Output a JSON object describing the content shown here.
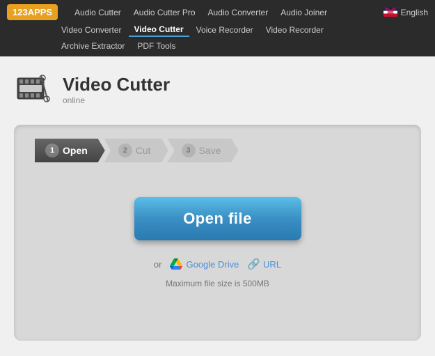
{
  "navbar": {
    "logo": "123APPS",
    "row1_links": [
      {
        "label": "Audio Cutter",
        "active": false
      },
      {
        "label": "Audio Cutter Pro",
        "active": false
      },
      {
        "label": "Audio Converter",
        "active": false
      },
      {
        "label": "Audio Joiner",
        "active": false
      }
    ],
    "row2_links": [
      {
        "label": "Video Converter",
        "active": false
      },
      {
        "label": "Video Cutter",
        "active": true
      },
      {
        "label": "Voice Recorder",
        "active": false
      },
      {
        "label": "Video Recorder",
        "active": false
      }
    ],
    "row3_links": [
      {
        "label": "Archive Extractor",
        "active": false
      },
      {
        "label": "PDF Tools",
        "active": false
      }
    ],
    "language": "English"
  },
  "app": {
    "title": "Video Cutter",
    "subtitle": "online"
  },
  "steps": [
    {
      "number": "1",
      "label": "Open",
      "active": true
    },
    {
      "number": "2",
      "label": "Cut",
      "active": false
    },
    {
      "number": "3",
      "label": "Save",
      "active": false
    }
  ],
  "main": {
    "open_button": "Open file",
    "or_label": "or",
    "google_drive_label": "Google Drive",
    "url_label": "URL",
    "file_size_note": "Maximum file size is 500MB"
  }
}
